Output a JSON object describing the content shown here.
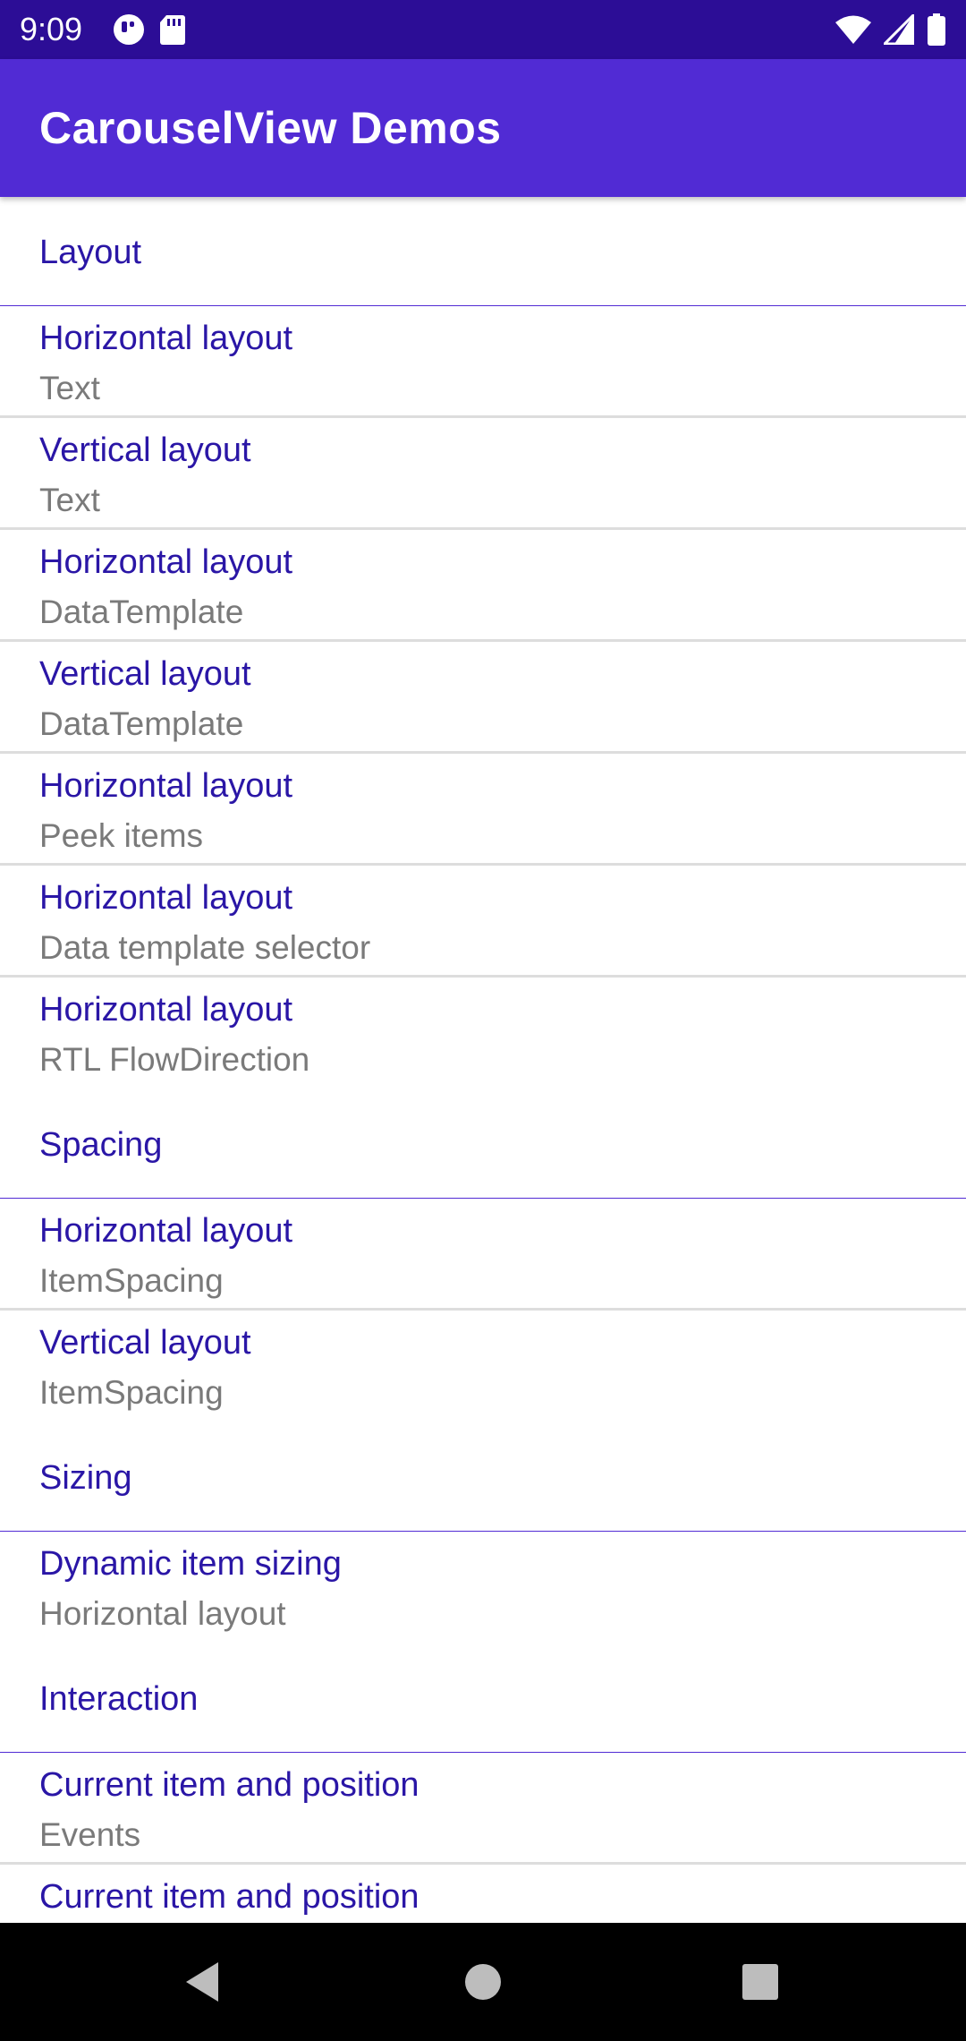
{
  "status_bar": {
    "time": "9:09",
    "left_icons": [
      "media-app-icon",
      "sd-card-icon"
    ],
    "right_icons": [
      "wifi-icon",
      "cellular-signal-icon",
      "battery-icon"
    ],
    "background_color": "#2C0D96"
  },
  "app_bar": {
    "title": "CarouselView Demos",
    "background_color": "#512BD4"
  },
  "groups": [
    {
      "header": "Layout",
      "items": [
        {
          "title": "Horizontal layout",
          "detail": "Text"
        },
        {
          "title": "Vertical layout",
          "detail": "Text"
        },
        {
          "title": "Horizontal layout",
          "detail": "DataTemplate"
        },
        {
          "title": "Vertical layout",
          "detail": "DataTemplate"
        },
        {
          "title": "Horizontal layout",
          "detail": "Peek items"
        },
        {
          "title": "Horizontal layout",
          "detail": "Data template selector"
        },
        {
          "title": "Horizontal layout",
          "detail": "RTL FlowDirection"
        }
      ]
    },
    {
      "header": "Spacing",
      "items": [
        {
          "title": "Horizontal layout",
          "detail": "ItemSpacing"
        },
        {
          "title": "Vertical layout",
          "detail": "ItemSpacing"
        }
      ]
    },
    {
      "header": "Sizing",
      "items": [
        {
          "title": "Dynamic item sizing",
          "detail": "Horizontal layout"
        }
      ]
    },
    {
      "header": "Interaction",
      "items": [
        {
          "title": "Current item and position",
          "detail": "Events"
        },
        {
          "title": "Current item and position",
          "detail": ""
        }
      ]
    }
  ],
  "colors": {
    "title_text": "#2A16A6",
    "detail_text": "#7A7A7A",
    "separator": "#DDDDDD"
  },
  "nav_bar": {
    "buttons": [
      "back-icon",
      "home-icon",
      "recents-icon"
    ]
  }
}
